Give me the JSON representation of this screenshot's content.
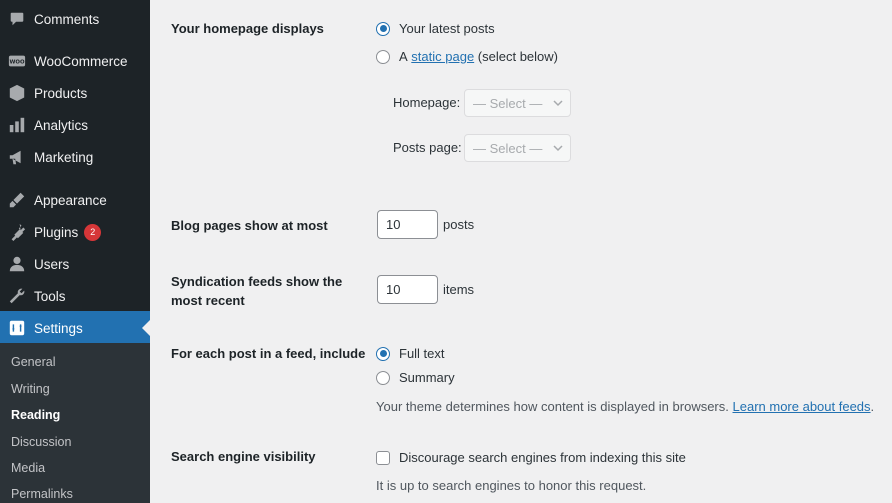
{
  "sidebar": {
    "items": [
      {
        "label": "Comments",
        "icon": "comment-icon"
      },
      {
        "label": "WooCommerce",
        "icon": "woo-icon"
      },
      {
        "label": "Products",
        "icon": "box-icon"
      },
      {
        "label": "Analytics",
        "icon": "bar-chart-icon"
      },
      {
        "label": "Marketing",
        "icon": "megaphone-icon"
      },
      {
        "label": "Appearance",
        "icon": "brush-icon"
      },
      {
        "label": "Plugins",
        "icon": "plug-icon",
        "badge": "2"
      },
      {
        "label": "Users",
        "icon": "user-icon"
      },
      {
        "label": "Tools",
        "icon": "wrench-icon"
      },
      {
        "label": "Settings",
        "icon": "settings-icon",
        "active": true
      }
    ],
    "submenu": [
      {
        "label": "General"
      },
      {
        "label": "Writing"
      },
      {
        "label": "Reading",
        "current": true
      },
      {
        "label": "Discussion"
      },
      {
        "label": "Media"
      },
      {
        "label": "Permalinks"
      }
    ]
  },
  "form": {
    "homepage_displays": {
      "label": "Your homepage displays",
      "option_latest": "Your latest posts",
      "option_static_prefix": "A",
      "option_static_link": "static page",
      "option_static_suffix": "(select below)",
      "selected": "latest",
      "homepage_label": "Homepage:",
      "homepage_value": "— Select —",
      "posts_page_label": "Posts page:",
      "posts_page_value": "— Select —"
    },
    "blog_pages": {
      "label": "Blog pages show at most",
      "value": "10",
      "unit": "posts"
    },
    "syndication": {
      "label_line1": "Syndication feeds show the",
      "label_line2": "most recent",
      "value": "10",
      "unit": "items"
    },
    "feed_include": {
      "label": "For each post in a feed, include",
      "option_full": "Full text",
      "option_summary": "Summary",
      "selected": "full",
      "description": "Your theme determines how content is displayed in browsers.",
      "link": "Learn more about feeds",
      "link_suffix": "."
    },
    "search_visibility": {
      "label": "Search engine visibility",
      "checkbox_label": "Discourage search engines from indexing this site",
      "checked": false,
      "description": "It is up to search engines to honor this request."
    }
  },
  "colors": {
    "sidebar_bg": "#1d2327",
    "active_bg": "#2271b1",
    "submenu_bg": "#2c3338",
    "badge": "#d63638",
    "link": "#2271b1",
    "content_bg": "#f0f0f1"
  }
}
